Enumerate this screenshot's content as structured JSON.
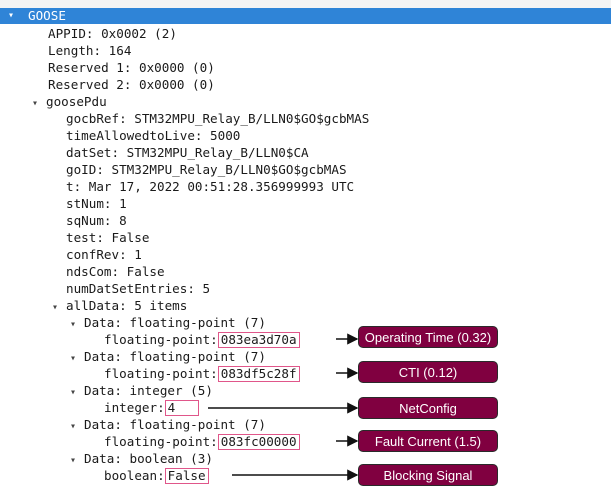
{
  "header": {
    "label": "GOOSE",
    "twisty": "▾"
  },
  "fields": {
    "appid": "APPID: 0x0002 (2)",
    "length": "Length: 164",
    "reserved1": "Reserved 1: 0x0000 (0)",
    "reserved2": "Reserved 2: 0x0000 (0)",
    "goosepdu": "goosePdu",
    "gocbref": "gocbRef: STM32MPU_Relay_B/LLN0$GO$gcbMAS",
    "ttl": "timeAllowedtoLive: 5000",
    "dataset": "datSet: STM32MPU_Relay_B/LLN0$CA",
    "goid": "goID: STM32MPU_Relay_B/LLN0$GO$gcbMAS",
    "t": "t: Mar 17, 2022 00:51:28.356999993 UTC",
    "stnum": "stNum: 1",
    "sqnum": "sqNum: 8",
    "test": "test: False",
    "confrev": "confRev: 1",
    "ndscom": "ndsCom: False",
    "numdatset": "numDatSetEntries: 5",
    "alldata": "allData: 5 items"
  },
  "data_items": [
    {
      "header": "Data: floating-point (7)",
      "key": "floating-point:",
      "value": " 083ea3d70a",
      "annotation": "Operating Time (0.32)"
    },
    {
      "header": "Data: floating-point (7)",
      "key": "floating-point:",
      "value": " 083df5c28f",
      "annotation": "CTI (0.12)"
    },
    {
      "header": "Data: integer (5)",
      "key": "integer:",
      "value": " 4",
      "annotation": "NetConfig"
    },
    {
      "header": "Data: floating-point (7)",
      "key": "floating-point:",
      "value": " 083fc00000",
      "annotation": "Fault Current (1.5)"
    },
    {
      "header": "Data: boolean (3)",
      "key": "boolean:",
      "value": " False",
      "annotation": "Blocking Signal"
    }
  ],
  "icons": {
    "expanded": "chevron-down-icon"
  },
  "colors": {
    "header_bg": "#2f84d7",
    "annotation_bg": "#800040",
    "highlight_border": "#e0568a"
  }
}
